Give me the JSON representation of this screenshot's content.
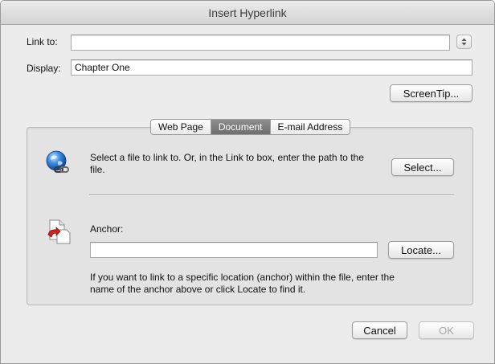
{
  "window": {
    "title": "Insert Hyperlink"
  },
  "fields": {
    "link_to_label": "Link to:",
    "link_to_value": "",
    "display_label": "Display:",
    "display_value": "Chapter One"
  },
  "buttons": {
    "screentip": "ScreenTip...",
    "select": "Select...",
    "locate": "Locate...",
    "cancel": "Cancel",
    "ok": "OK"
  },
  "tabs": [
    {
      "label": "Web Page",
      "active": false
    },
    {
      "label": "Document",
      "active": true
    },
    {
      "label": "E-mail Address",
      "active": false
    }
  ],
  "document_tab": {
    "select_desc": "Select a file to link to. Or, in the Link to box, enter the path to the file.",
    "anchor_label": "Anchor:",
    "anchor_value": "",
    "anchor_desc": "If you want to link to a specific location (anchor) within the file, enter the name of the anchor above or click Locate to find it."
  },
  "icons": {
    "file_link": "globe-link-icon",
    "anchor": "document-anchor-icon",
    "stepper": "up-down-stepper-icon"
  }
}
